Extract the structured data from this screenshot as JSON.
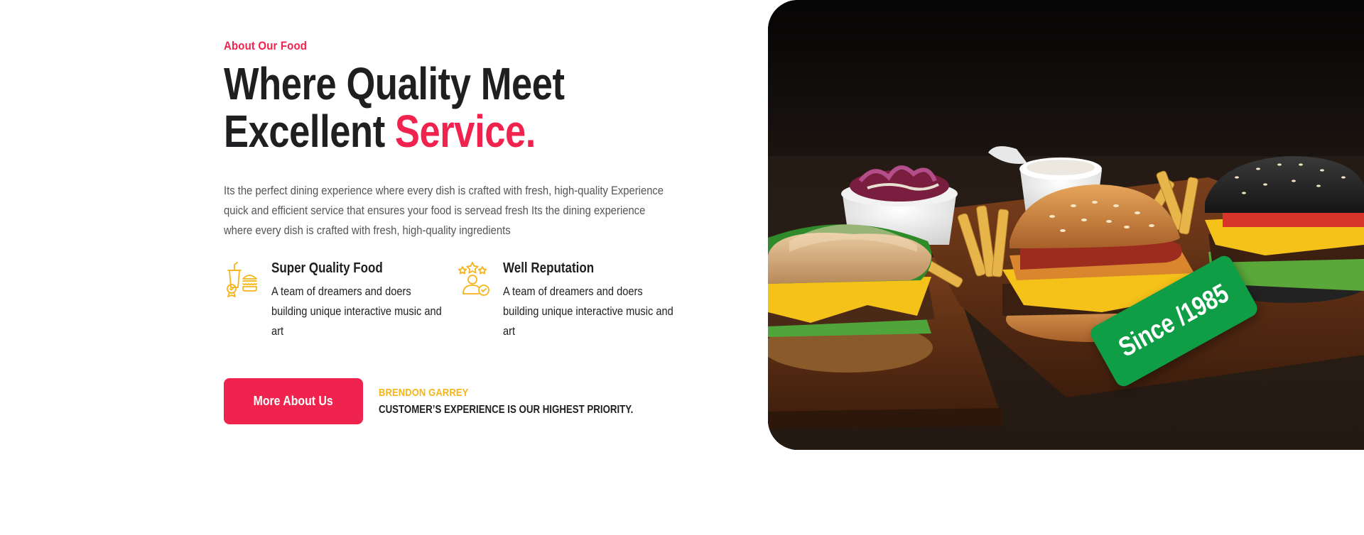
{
  "about": {
    "eyebrow": "About Our Food",
    "heading_line1": "Where Quality Meet",
    "heading_line2_plain": "Excellent ",
    "heading_line2_accent": "Service.",
    "description": "Its the perfect dining experience where every dish is crafted with fresh, high-quality Experience quick and efficient service that ensures your food is servead fresh Its the dining experience where every dish is crafted with fresh, high-quality ingredients"
  },
  "features": [
    {
      "icon": "food-quality-icon",
      "title": "Super Quality Food",
      "text": "A team of dreamers and doers building unique interactive music and art"
    },
    {
      "icon": "reputation-icon",
      "title": "Well Reputation",
      "text": "A team of dreamers and doers building unique interactive music and art"
    }
  ],
  "cta": {
    "button_label": "More About Us",
    "author_name": "BRENDON GARREY",
    "author_quote": "CUSTOMER’S EXPERIENCE IS OUR HIGHEST PRIORITY."
  },
  "hero": {
    "badge_text": "Since /1985"
  },
  "colors": {
    "accent": "#f0234f",
    "icon_yellow": "#f5b41a",
    "badge_green": "#0f9d46",
    "text_dark": "#1f1f22"
  }
}
